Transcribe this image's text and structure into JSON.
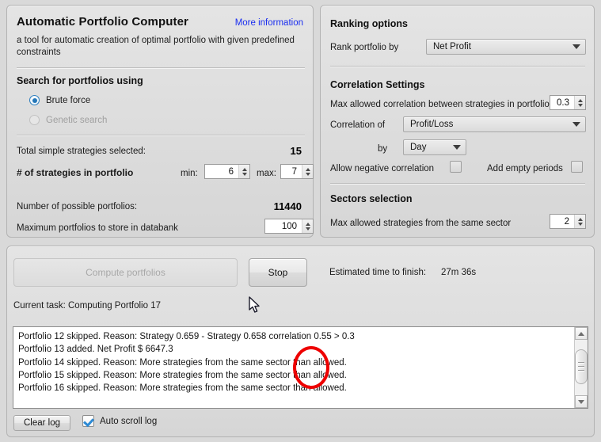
{
  "left_panel": {
    "title": "Automatic Portfolio Computer",
    "more_info_link": "More information",
    "description": "a tool for automatic creation of optimal portfolio with given predefined constraints",
    "search_section_title": "Search for portfolios using",
    "radio_brute_force": "Brute force",
    "radio_genetic_search": "Genetic search",
    "total_strategies_label": "Total simple strategies selected:",
    "total_strategies_value": "15",
    "num_strategies_label": "# of strategies in portfolio",
    "min_label": "min:",
    "min_value": "6",
    "max_label": "max:",
    "max_value": "7",
    "possible_portfolios_label": "Number of possible portfolios:",
    "possible_portfolios_value": "11440",
    "max_store_label": "Maximum portfolios to store in databank",
    "max_store_value": "100"
  },
  "right_panel": {
    "ranking_title": "Ranking options",
    "rank_by_label": "Rank portfolio by",
    "rank_by_value": "Net Profit",
    "correlation_title": "Correlation Settings",
    "max_corr_label": "Max allowed correlation between strategies in portfolio",
    "max_corr_value": "0.3",
    "correlation_of_label": "Correlation of",
    "correlation_of_value": "Profit/Loss",
    "by_label": "by",
    "by_value": "Day",
    "allow_negative_label": "Allow negative correlation",
    "allow_negative_checked": false,
    "add_empty_label": "Add empty periods",
    "add_empty_checked": false,
    "sectors_title": "Sectors selection",
    "max_sector_label": "Max allowed strategies from the same sector",
    "max_sector_value": "2"
  },
  "bottom_panel": {
    "compute_button": "Compute portfolios",
    "compute_disabled": true,
    "stop_button": "Stop",
    "estimated_label": "Estimated time to finish:",
    "estimated_value": "27m 36s",
    "current_task_label": "Current task:",
    "current_task_value": "Computing Portfolio 17",
    "log_lines": [
      "Portfolio 12 skipped. Reason: Strategy 0.659 - Strategy 0.658 correlation 0.55 > 0.3",
      "Portfolio 13 added. Net Profit $ 6647.3",
      "Portfolio 14 skipped. Reason: More strategies from the same sector than allowed.",
      "Portfolio 15 skipped. Reason: More strategies from the same sector than allowed.",
      "Portfolio 16 skipped. Reason: More strategies from the same sector than allowed."
    ],
    "clear_log_button": "Clear log",
    "auto_scroll_label": "Auto scroll log",
    "auto_scroll_checked": true
  },
  "annotation": {
    "shape": "ellipse",
    "color": "#ee0000"
  }
}
